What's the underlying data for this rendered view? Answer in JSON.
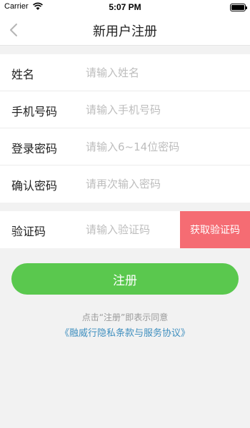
{
  "status_bar": {
    "carrier": "Carrier",
    "time": "5:07 PM"
  },
  "nav": {
    "title": "新用户注册",
    "back_icon": "chevron-left-icon"
  },
  "form": {
    "fields": [
      {
        "label": "姓名",
        "placeholder": "请输入姓名"
      },
      {
        "label": "手机号码",
        "placeholder": "请输入手机号码"
      },
      {
        "label": "登录密码",
        "placeholder": "请输入6~14位密码"
      },
      {
        "label": "确认密码",
        "placeholder": "请再次输入密码"
      }
    ],
    "code": {
      "label": "验证码",
      "placeholder": "请输入验证码",
      "button_label": "获取验证码"
    }
  },
  "register_label": "注册",
  "agreement": {
    "note": "点击“注册”即表示同意",
    "link": "《融威行隐私条款与服务协议》"
  },
  "colors": {
    "accent_green": "#5ac84e",
    "code_button": "#f56c73",
    "link": "#3f8fbf"
  }
}
